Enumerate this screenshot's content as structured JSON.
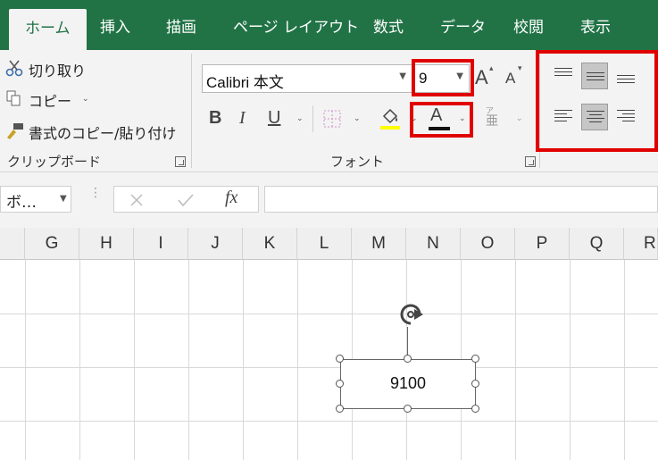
{
  "tabs": [
    "ホーム",
    "挿入",
    "描画",
    "ページ レイアウト",
    "数式",
    "データ",
    "校閲",
    "表示"
  ],
  "clipboard": {
    "cut": "切り取り",
    "copy": "コピー",
    "format_painter": "書式のコピー/貼り付け",
    "group_label": "クリップボード"
  },
  "font": {
    "name": "Calibri 本文",
    "size": "9",
    "group_label": "フォント"
  },
  "name_box": "ボ…",
  "columns": [
    "G",
    "H",
    "I",
    "J",
    "K",
    "L",
    "M",
    "N",
    "O",
    "P",
    "Q",
    "R"
  ],
  "shape": {
    "text": "9100"
  },
  "colors": {
    "accent": "#217346",
    "highlight_box": "#e00000"
  }
}
